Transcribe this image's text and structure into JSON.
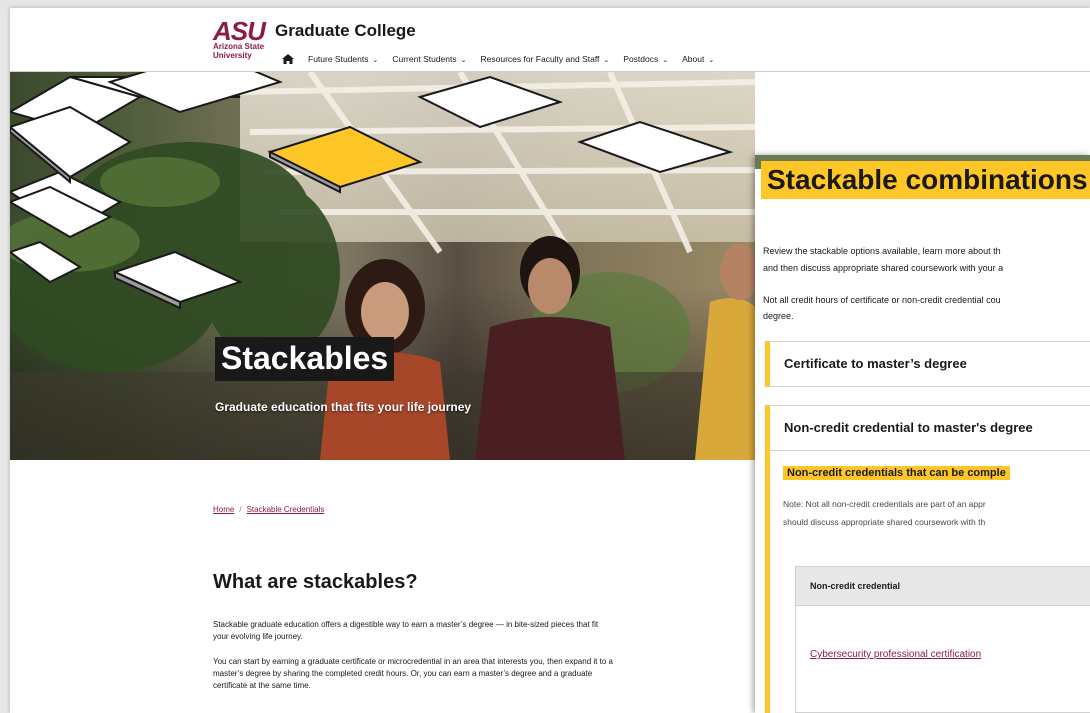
{
  "header": {
    "logo_text": "ASU",
    "logo_sub1": "Arizona State",
    "logo_sub2": "University",
    "site_title": "Graduate College",
    "nav": [
      {
        "label": "Future Students"
      },
      {
        "label": "Current Students"
      },
      {
        "label": "Resources for Faculty and Staff"
      },
      {
        "label": "Postdocs"
      },
      {
        "label": "About"
      }
    ]
  },
  "hero": {
    "title": "Stackables",
    "subtitle": "Graduate education that fits your life journey"
  },
  "breadcrumb": {
    "home": "Home",
    "separator": "/",
    "current": "Stackable Credentials"
  },
  "what": {
    "heading": "What are stackables?",
    "p1": "Stackable graduate education offers a digestible way to earn a master’s degree — in bite-sized pieces that fit your evolving life journey.",
    "p2": "You can start by earning a graduate certificate or microcredential in an area that interests you, then expand it to a master’s degree by sharing the completed credit hours. Or, you can earn a master’s degree and a graduate certificate at the same time."
  },
  "panel": {
    "title": "Stackable combinations",
    "intro1": "Review the stackable options available, learn more about th",
    "intro2": "and then discuss appropriate shared coursework with your a",
    "intro3": "Not all credit hours of certificate or non-credit credential cou",
    "intro4": "degree.",
    "accordion1": "Certificate to master’s degree",
    "accordion2": "Non-credit credential to master's degree",
    "sub_heading": "Non-credit credentials that can be comple",
    "note1": "Note: Not all non-credit credentials are part of an appr",
    "note2": "should discuss appropriate shared coursework with th",
    "table_header": "Non-credit credential",
    "table_link": "Cybersecurity professional certification"
  },
  "colors": {
    "maroon": "#8c1d40",
    "gold": "#ffc627",
    "dark": "#191919"
  },
  "icons": {
    "home": "home-icon",
    "chevron": "chevron-down-icon"
  }
}
